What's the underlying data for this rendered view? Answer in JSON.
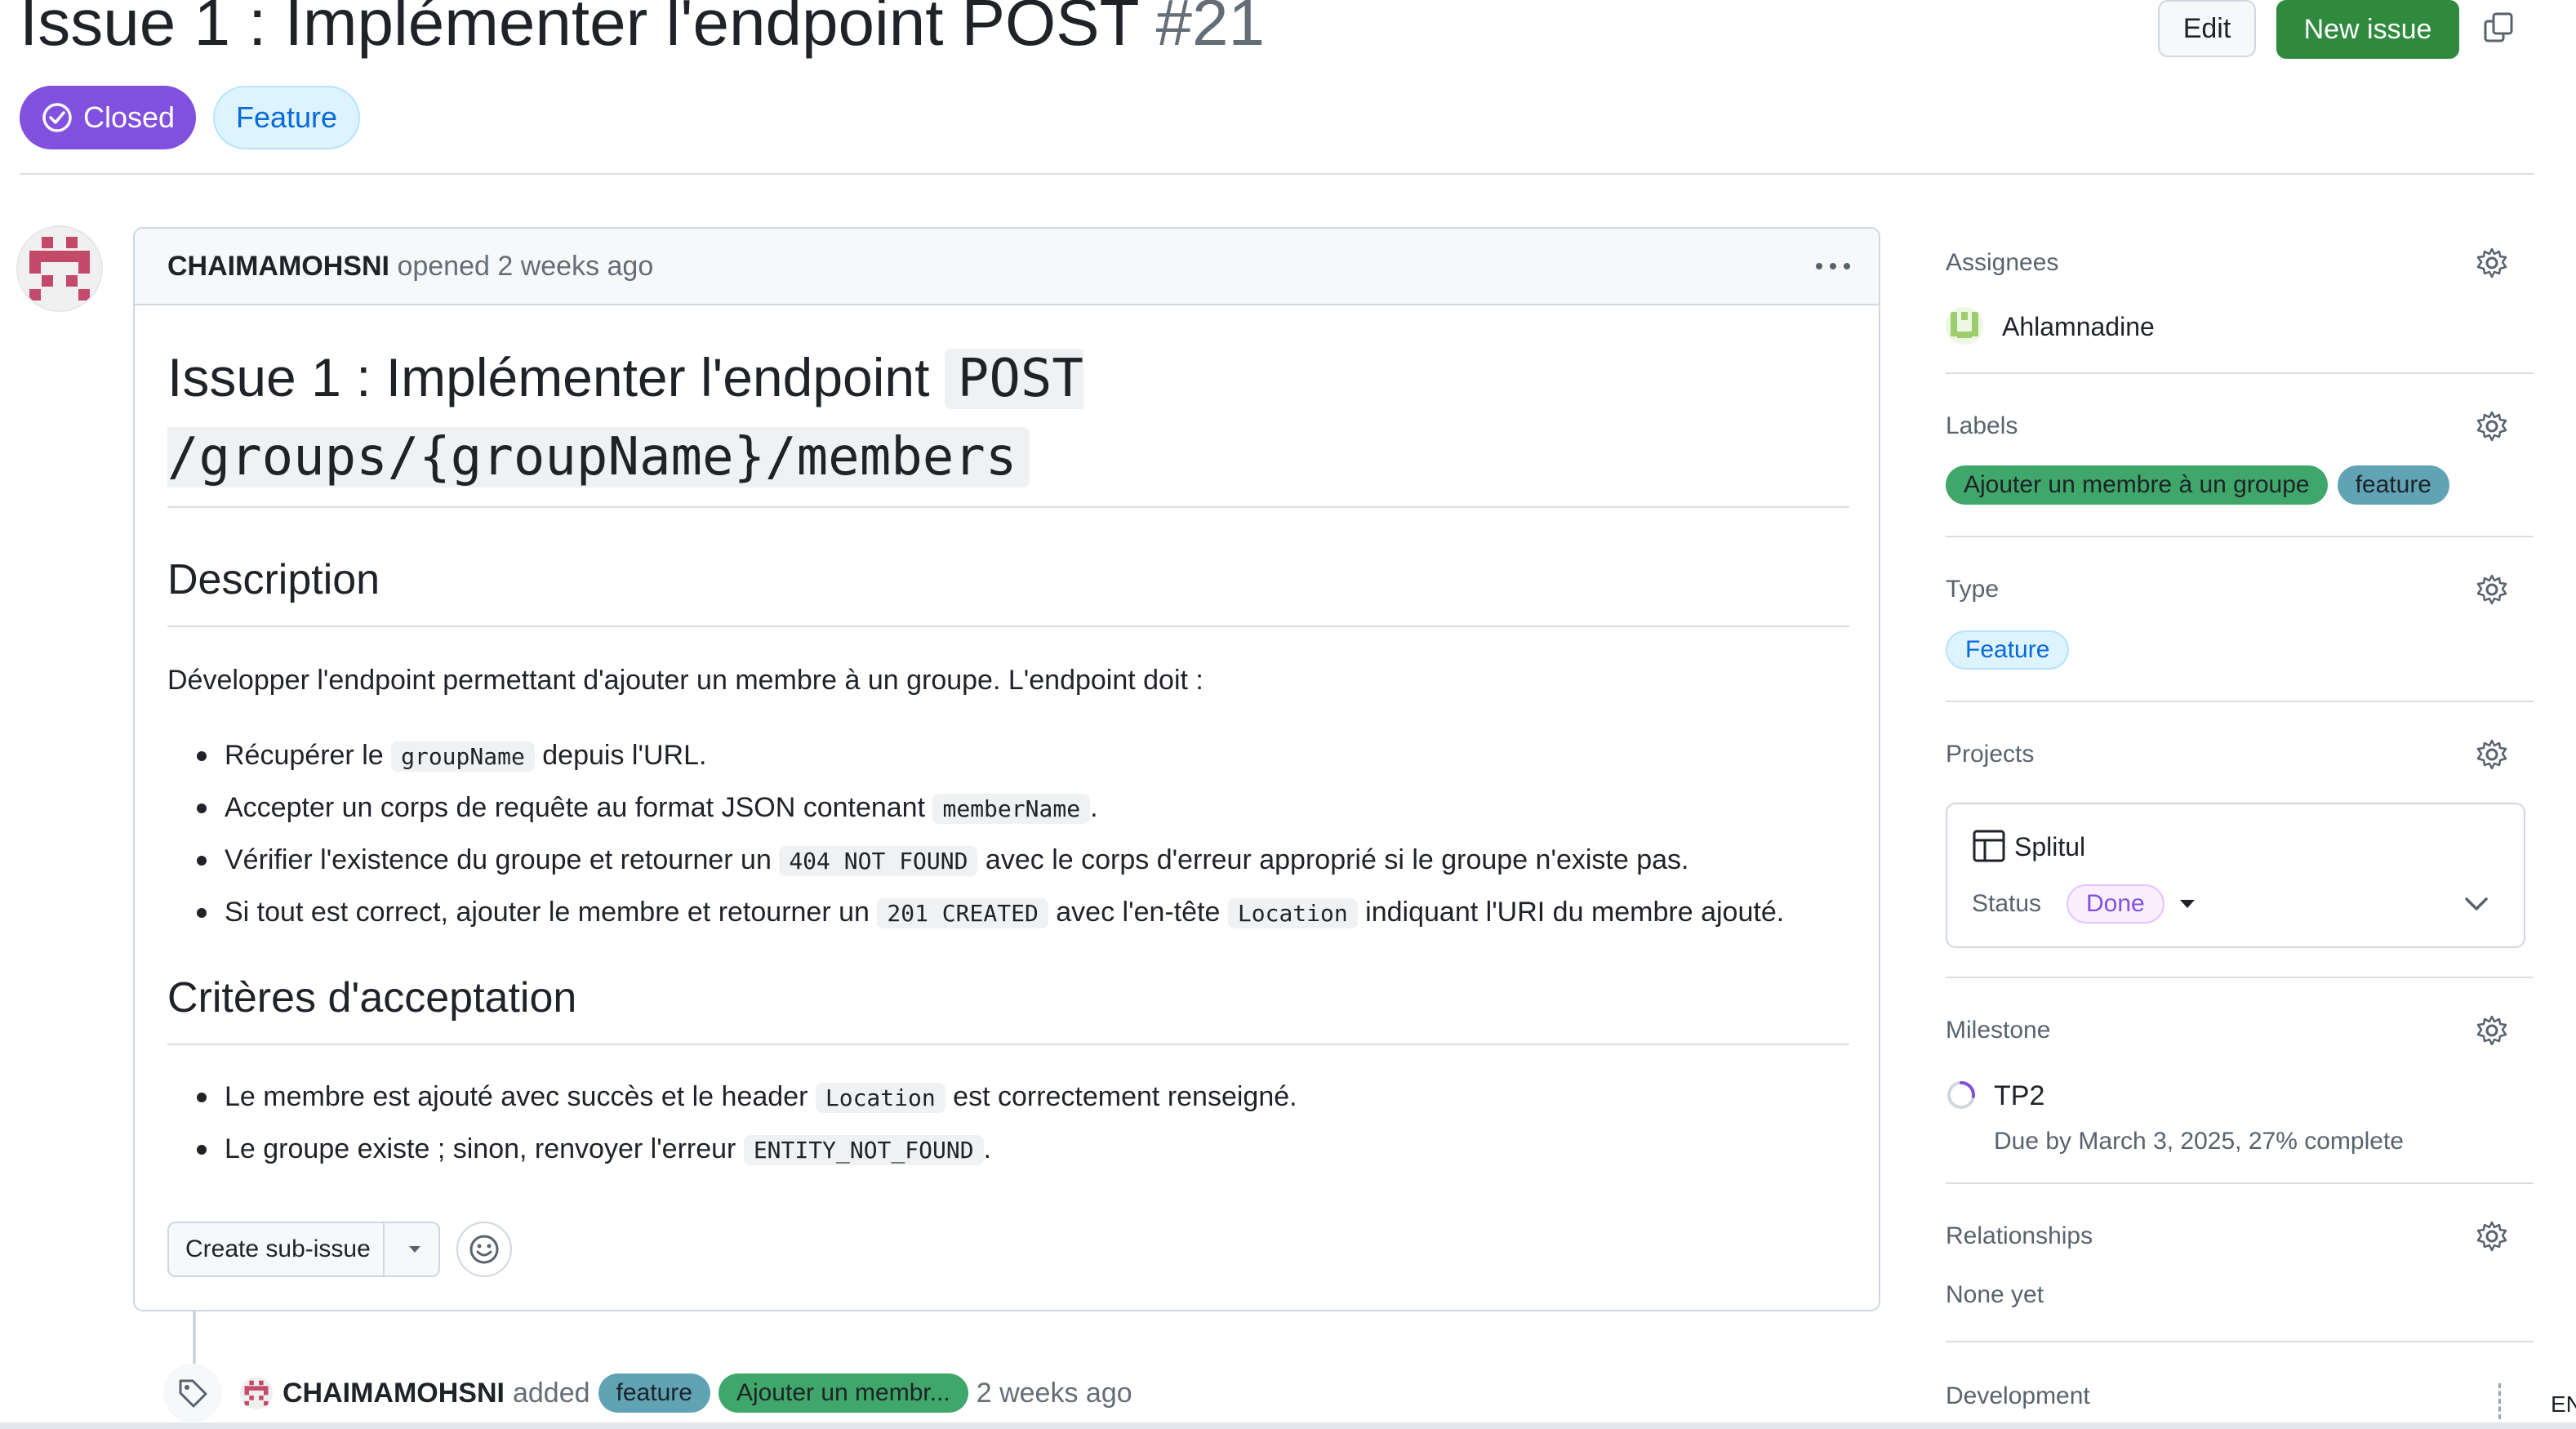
{
  "issue": {
    "title": "Issue 1 : Implémenter l'endpoint POST",
    "number": "#21",
    "state": "Closed",
    "type_badge": "Feature"
  },
  "header_actions": {
    "edit": "Edit",
    "new_issue": "New issue"
  },
  "comment": {
    "author": "CHAIMAMOHSNI",
    "meta": "opened 2 weeks ago",
    "h1_text": "Issue 1 : Implémenter l'endpoint ",
    "h1_code": "POST /groups/{groupName}/members",
    "description_heading": "Description",
    "description_intro": "Développer l'endpoint permettant d'ajouter un membre à un groupe. L'endpoint doit :",
    "description_items": [
      {
        "t1": "Récupérer le ",
        "code": "groupName",
        "t2": " depuis l'URL."
      },
      {
        "t1": "Accepter un corps de requête au format JSON contenant ",
        "code": "memberName",
        "t2": "."
      },
      {
        "t1": "Vérifier l'existence du groupe et retourner un ",
        "code": "404 NOT FOUND",
        "t2": " avec le corps d'erreur approprié si le groupe n'existe pas."
      },
      {
        "t1": "Si tout est correct, ajouter le membre et retourner un ",
        "code": "201 CREATED",
        "t2": " avec l'en-tête ",
        "code2": "Location",
        "t3": " indiquant l'URI du membre ajouté."
      }
    ],
    "criteria_heading": "Critères d'acceptation",
    "criteria_items": [
      {
        "t1": "Le membre est ajouté avec succès et le header ",
        "code": "Location",
        "t2": " est correctement renseigné."
      },
      {
        "t1": "Le groupe existe ; sinon, renvoyer l'erreur ",
        "code": "ENTITY_NOT_FOUND",
        "t2": "."
      }
    ],
    "create_sub_issue": "Create sub-issue"
  },
  "timeline": {
    "author": "CHAIMAMOHSNI",
    "action": "added",
    "labels": [
      "feature",
      "Ajouter un membr..."
    ],
    "time": "2 weeks ago"
  },
  "sidebar": {
    "assignees_title": "Assignees",
    "assignee": "Ahlamnadine",
    "labels_title": "Labels",
    "labels": [
      "Ajouter un membre à un groupe",
      "feature"
    ],
    "type_title": "Type",
    "type_value": "Feature",
    "projects_title": "Projects",
    "project_name": "Splitul",
    "status_label": "Status",
    "status_value": "Done",
    "milestone_title": "Milestone",
    "milestone_name": "TP2",
    "milestone_due": "Due by March 3, 2025, 27% complete",
    "milestone_progress": 0.27,
    "relationships_title": "Relationships",
    "relationships_value": "None yet",
    "development_title": "Development",
    "corner_text": "EN"
  },
  "colors": {
    "closed_purple": "#8250df",
    "new_issue_green": "#2f8a3e",
    "label_ajouter": "#3fa76a",
    "label_feature": "#5fa3b4"
  },
  "icons": [
    "copy-icon",
    "check-circle-icon",
    "kebab-icon",
    "gear-icon",
    "table-icon",
    "chevron-down-icon",
    "caret-down-icon",
    "smiley-icon",
    "tag-icon",
    "milestone-icon"
  ]
}
